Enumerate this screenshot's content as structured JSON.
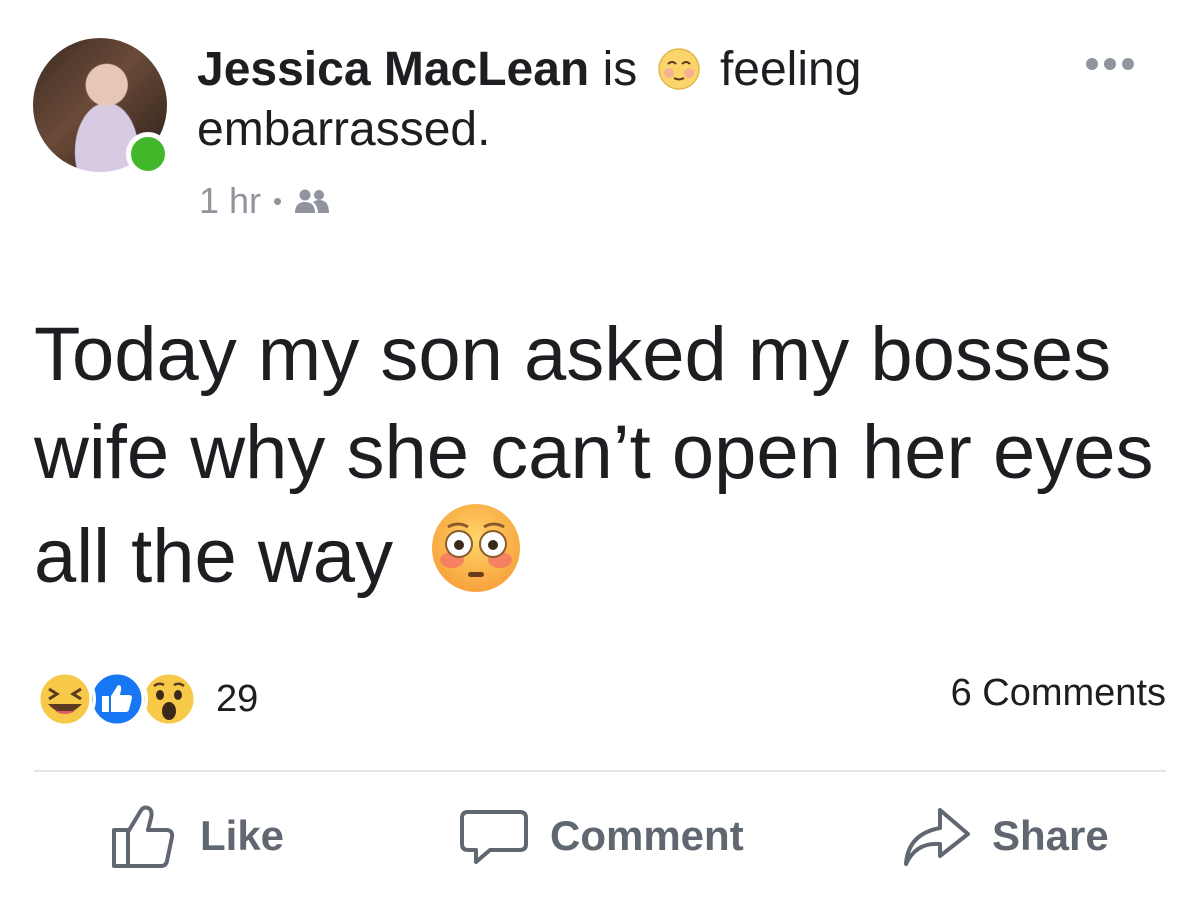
{
  "post": {
    "author": "Jessica MacLean",
    "is_text": "is",
    "feeling_text": "feeling",
    "feeling_value": "embarrassed.",
    "timestamp": "1 hr",
    "separator": "•",
    "audience_icon": "friends-icon",
    "body": "Today my son asked my bosses wife why she can’t open her eyes all the way"
  },
  "stats": {
    "reaction_count": "29",
    "comments_label": "6 Comments",
    "reactions": [
      "haha",
      "like",
      "wow"
    ]
  },
  "actions": {
    "like_label": "Like",
    "comment_label": "Comment",
    "share_label": "Share"
  },
  "colors": {
    "text": "#1c1e21",
    "secondary": "#90949c",
    "action": "#606770",
    "online": "#42b72a",
    "like_blue": "#1877f2"
  }
}
